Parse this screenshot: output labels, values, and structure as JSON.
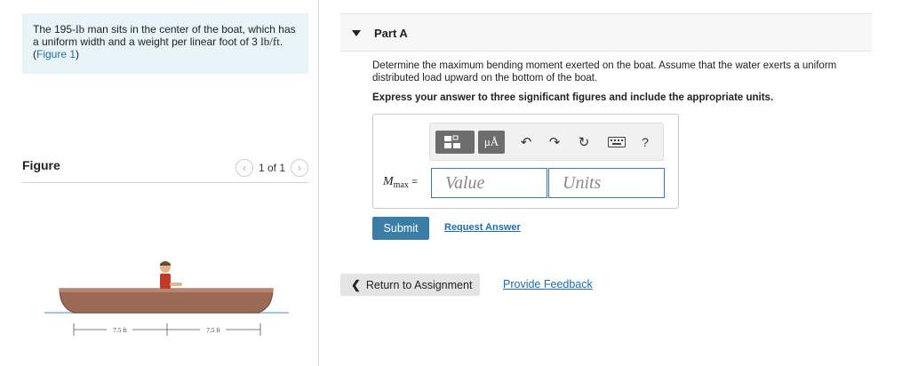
{
  "problem": {
    "text_before": "The 195-",
    "weight_unit": "lb",
    "text_middle": " man sits in the center of the boat, which has a uniform width and a weight per linear foot of 3 ",
    "load_unit": "lb/ft",
    "text_end": ".",
    "figure_link": "Figure 1",
    "paren_open": "(",
    "paren_close": ")"
  },
  "figure": {
    "title": "Figure",
    "pager_text": "1 of 1",
    "prev_icon": "chevron-left-icon",
    "next_icon": "chevron-right-icon",
    "dim_left": "7.5 ft",
    "dim_right": "7.5 ft"
  },
  "part": {
    "title": "Part A",
    "question": "Determine the maximum bending moment exerted on the boat. Assume that the water exerts a uniform distributed load upward on the bottom of the boat.",
    "instruction": "Express your answer to three significant figures and include the appropriate units."
  },
  "toolbar": {
    "units_label": "μÅ",
    "help_label": "?",
    "undo_icon": "undo-icon",
    "redo_icon": "redo-icon",
    "reset_icon": "reset-icon",
    "keyboard_icon": "keyboard-icon"
  },
  "answer": {
    "variable": "M",
    "subscript": "max",
    "equals": "=",
    "value_placeholder": "Value",
    "units_placeholder": "Units"
  },
  "actions": {
    "submit_label": "Submit",
    "request_answer_label": "Request Answer",
    "return_label": "Return to Assignment",
    "feedback_label": "Provide Feedback"
  },
  "colors": {
    "problem_bg": "#e8f4f7",
    "link": "#1a6fb0",
    "submit_bg": "#3a7ea8",
    "boat_hull": "#9b6a55",
    "shirt": "#c0392b"
  }
}
